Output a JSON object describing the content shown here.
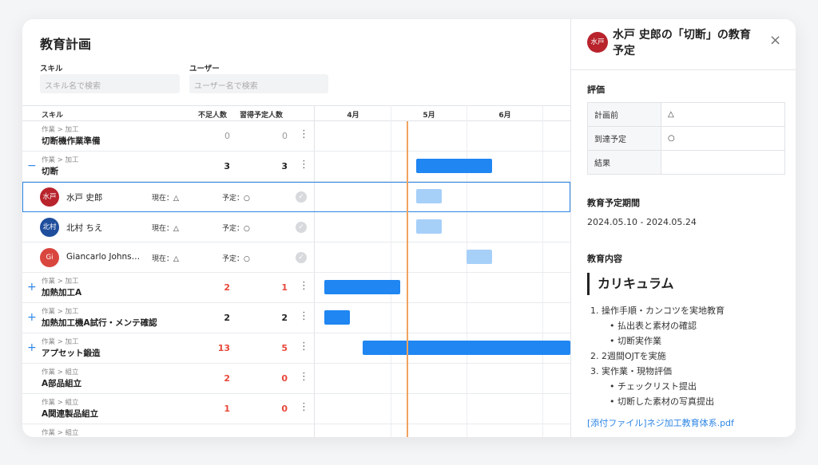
{
  "page": {
    "title": "教育計画"
  },
  "filters": {
    "skill_label": "スキル",
    "skill_placeholder": "スキル名で検索",
    "user_label": "ユーザー",
    "user_placeholder": "ユーザー名で検索"
  },
  "table_header": {
    "skill": "スキル",
    "short": "不足人数",
    "plan": "習得予定人数",
    "months": [
      "4月",
      "5月",
      "6月"
    ]
  },
  "rows": [
    {
      "type": "skill",
      "cat": "作業 > 加工",
      "name": "切断機作業準備",
      "short": "0",
      "plan": "0",
      "toggle": ""
    },
    {
      "type": "skill",
      "cat": "作業 > 加工",
      "name": "切断",
      "short": "3",
      "plan": "3",
      "toggle": "−"
    },
    {
      "type": "user",
      "avatar": "水戸",
      "avatar_color": "#b8232c",
      "name": "水戸 史郎",
      "current": "現在：△",
      "planned": "予定：○",
      "check": "✓"
    },
    {
      "type": "user",
      "avatar": "北村",
      "avatar_color": "#1f4e9c",
      "name": "北村 ちえ",
      "current": "現在：△",
      "planned": "予定：○",
      "check": "✓"
    },
    {
      "type": "user",
      "avatar": "Gi",
      "avatar_color": "#d9463e",
      "name": "Giancarlo Johns…",
      "current": "現在：△",
      "planned": "予定：○",
      "check": "✓"
    },
    {
      "type": "skill",
      "cat": "作業 > 加工",
      "name": "加熱加工A",
      "short": "2",
      "plan": "1",
      "toggle": "+"
    },
    {
      "type": "skill",
      "cat": "作業 > 加工",
      "name": "加熱加工機A試行・メンテ確認",
      "short": "2",
      "plan": "2",
      "toggle": "+"
    },
    {
      "type": "skill",
      "cat": "作業 > 加工",
      "name": "アプセット鍛造",
      "short": "13",
      "plan": "5",
      "toggle": "+"
    },
    {
      "type": "skill",
      "cat": "作業 > 組立",
      "name": "A部品組立",
      "short": "2",
      "plan": "0",
      "toggle": ""
    },
    {
      "type": "skill",
      "cat": "作業 > 組立",
      "name": "A関連製品組立",
      "short": "1",
      "plan": "0",
      "toggle": ""
    },
    {
      "type": "skill",
      "cat": "作業 > 組立",
      "name": "",
      "short": "",
      "plan": "",
      "toggle": ""
    }
  ],
  "detail": {
    "avatar": "水戸",
    "title": "水戸 史郎の「切断」の教育予定",
    "close_icon": "×",
    "evaluation_label": "評価",
    "evaluation": [
      {
        "key": "計画前",
        "value": "△"
      },
      {
        "key": "到達予定",
        "value": "○"
      },
      {
        "key": "結果",
        "value": ""
      }
    ],
    "period_label": "教育予定期間",
    "period": "2024.05.10 - 2024.05.24",
    "content_label": "教育内容",
    "curriculum_title": "カリキュラム",
    "curriculum": [
      {
        "level": 1,
        "text": "1. 操作手順・カンコツを実地教育"
      },
      {
        "level": 2,
        "text": "• 払出表と素材の確認"
      },
      {
        "level": 2,
        "text": "• 切断実作業"
      },
      {
        "level": 1,
        "text": "2. 2週間OJTを実施"
      },
      {
        "level": 1,
        "text": "3. 実作業・現物評価"
      },
      {
        "level": 2,
        "text": "• チェックリスト提出"
      },
      {
        "level": 2,
        "text": "• 切断した素材の写真提出"
      }
    ],
    "attachment": "[添付ファイル]ネジ加工教育体系.pdf"
  },
  "colors": {
    "accent": "#1f86f2",
    "accent_light": "#a7d0f9",
    "today": "#f0a35e",
    "alert": "#e8483b"
  }
}
